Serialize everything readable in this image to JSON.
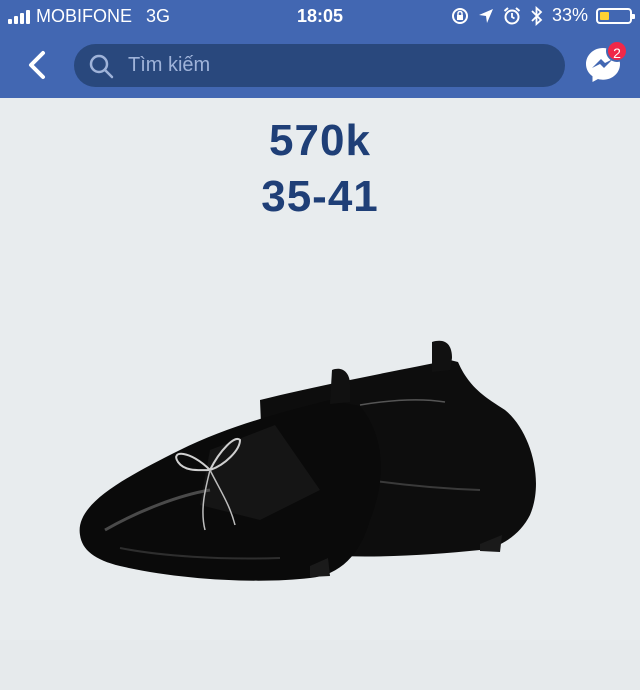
{
  "status_bar": {
    "carrier": "MOBIFONE",
    "network": "3G",
    "time": "18:05",
    "battery": "33%",
    "battery_level": 0.33
  },
  "navbar": {
    "search_placeholder": "Tìm kiếm",
    "messenger_badge": "2"
  },
  "post": {
    "price": "570k",
    "sizes": "35-41"
  },
  "colors": {
    "header": "#4267b2",
    "search_bg": "#29487d",
    "text_accent": "#1f3f77",
    "badge": "#f02849",
    "battery": "#ffd233"
  }
}
